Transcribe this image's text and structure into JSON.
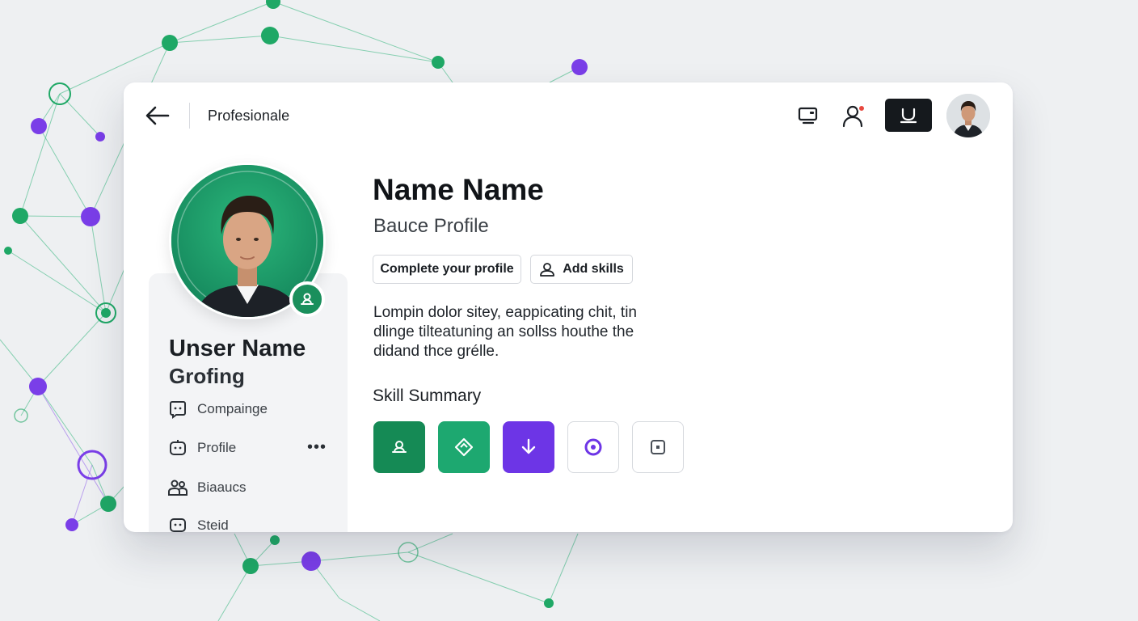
{
  "header": {
    "title": "Profesionale",
    "icons": [
      "back-arrow-icon",
      "monitor-icon",
      "user-icon",
      "inbox-icon",
      "avatar"
    ],
    "notification": true
  },
  "sidebar": {
    "user_name": "Unser Name",
    "user_subtitle": "Grofing",
    "items": [
      {
        "label": "Compainge",
        "icon": "chat-bubble-icon"
      },
      {
        "label": "Profile",
        "icon": "robot-icon"
      },
      {
        "label": "Biaaucs",
        "icon": "people-icon"
      },
      {
        "label": "Steid",
        "icon": "chat-icon"
      }
    ]
  },
  "profile": {
    "name": "Name Name",
    "subtitle": "Bauce Profile",
    "complete_btn": "Complete your profile",
    "add_skills_btn": "Add skills",
    "bio": "Lompin dolor sitey, eappicating chit, tin dlinge tilteatuning an sollss houthe the didand thce grélle."
  },
  "skills": {
    "title": "Skill Summary",
    "items": [
      {
        "icon": "user-icon",
        "style": "filled",
        "color": "#158a55"
      },
      {
        "icon": "diamond-icon",
        "style": "filled",
        "color": "#1da870"
      },
      {
        "icon": "download-arrow-icon",
        "style": "filled",
        "color": "#6d35e6"
      },
      {
        "icon": "target-icon",
        "style": "outline",
        "color": "#6d35e6"
      },
      {
        "icon": "square-icon",
        "style": "outline",
        "color": "#4a5058"
      }
    ]
  },
  "colors": {
    "green": "#1f9d66",
    "purple": "#7a3ee8",
    "dark": "#15191d",
    "background": "#eef0f2"
  }
}
